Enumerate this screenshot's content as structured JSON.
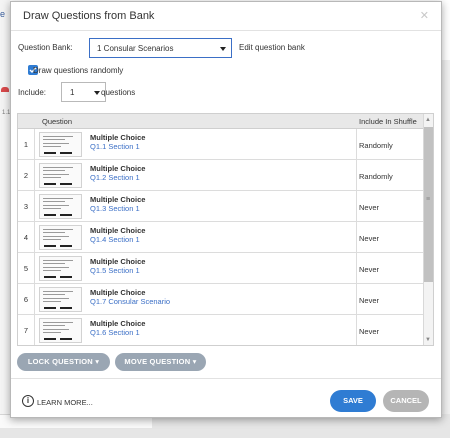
{
  "background": {
    "tab_fragment": "e",
    "side_fragment": "1.1"
  },
  "modal": {
    "title": "Draw Questions from Bank",
    "close_icon": "close-icon"
  },
  "bank": {
    "label": "Question Bank:",
    "selected": "1 Consular Scenarios",
    "edit_link": "Edit question bank"
  },
  "random": {
    "checked": true,
    "label": "Draw questions randomly"
  },
  "include": {
    "label": "Include:",
    "value": "1",
    "suffix": "questions"
  },
  "table": {
    "headers": [
      "Question",
      "Include In Shuffle"
    ],
    "rows": [
      {
        "num": "1",
        "type": "Multiple Choice",
        "section": "Q1.1 Section 1",
        "shuffle": "Randomly"
      },
      {
        "num": "2",
        "type": "Multiple Choice",
        "section": "Q1.2 Section 1",
        "shuffle": "Randomly"
      },
      {
        "num": "3",
        "type": "Multiple Choice",
        "section": "Q1.3 Section 1",
        "shuffle": "Never"
      },
      {
        "num": "4",
        "type": "Multiple Choice",
        "section": "Q1.4 Section 1",
        "shuffle": "Never"
      },
      {
        "num": "5",
        "type": "Multiple Choice",
        "section": "Q1.5 Section 1",
        "shuffle": "Never"
      },
      {
        "num": "6",
        "type": "Multiple Choice",
        "section": "Q1.7 Consular Scenario",
        "shuffle": "Never"
      },
      {
        "num": "7",
        "type": "Multiple Choice",
        "section": "Q1.6 Section 1",
        "shuffle": "Never"
      }
    ]
  },
  "actions": {
    "lock": "LOCK QUESTION",
    "move": "MOVE QUESTION"
  },
  "footer": {
    "learn_more": "LEARN MORE...",
    "save": "SAVE",
    "cancel": "CANCEL"
  },
  "colors": {
    "accent": "#2f7cd3",
    "pill": "#9aa6b3",
    "cancel": "#b5b5b5"
  }
}
